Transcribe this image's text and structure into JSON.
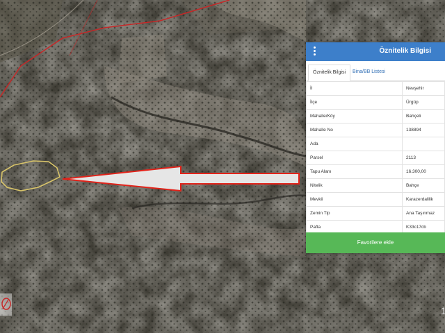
{
  "panel": {
    "title": "Öznitelik Bilgisi",
    "menu_icon": "vertical-dots-icon",
    "tabs": [
      {
        "label": "Öznitelik Bilgisi",
        "active": true
      },
      {
        "label": "Bina/BB Listesi",
        "active": false
      }
    ],
    "rows": [
      {
        "key": "İl",
        "value": "Nevşehir"
      },
      {
        "key": "İlçe",
        "value": "Ürgüp"
      },
      {
        "key": "Mahalle/Köy",
        "value": "Bahçeli"
      },
      {
        "key": "Mahalle No",
        "value": "138894"
      },
      {
        "key": "Ada",
        "value": ""
      },
      {
        "key": "Parsel",
        "value": "2113"
      },
      {
        "key": "Tapu Alanı",
        "value": "16.300,00"
      },
      {
        "key": "Nitelik",
        "value": "Bahçe"
      },
      {
        "key": "Mevkii",
        "value": "Karazerdalilik"
      },
      {
        "key": "Zemin Tip",
        "value": "Ana Taşınmaz"
      },
      {
        "key": "Pafta",
        "value": "K33c17cb"
      }
    ],
    "favorite_button": "Favorilere ekle"
  },
  "map": {
    "arrow_fill": "#e6e6e6",
    "arrow_stroke": "#e2231a",
    "parcel_outline": "#d8c46a",
    "boundary_color": "#c62828",
    "corner_icon": "location-marker-icon",
    "page_number": "1"
  },
  "colors": {
    "header": "#3d7fca",
    "button": "#57b857",
    "link": "#2e6db4"
  }
}
